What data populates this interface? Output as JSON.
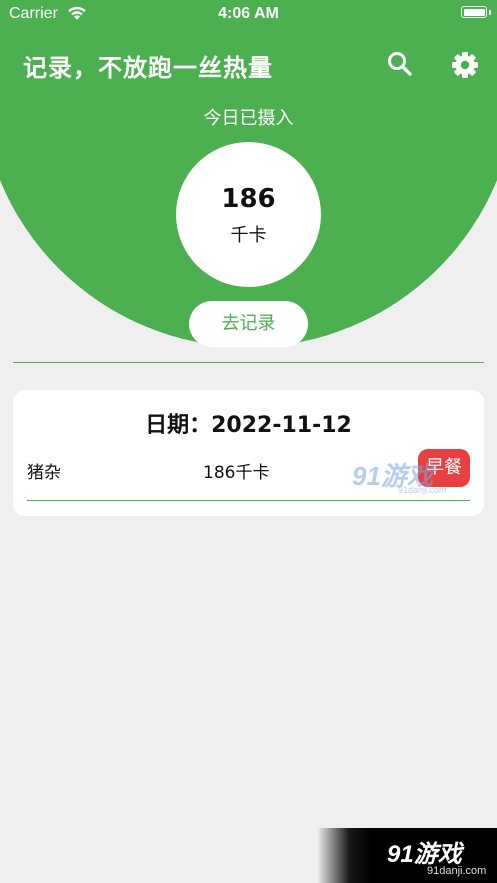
{
  "status_bar": {
    "carrier": "Carrier",
    "time": "4:06 AM"
  },
  "header": {
    "title": "记录，不放跑一丝热量",
    "search_icon": "search-icon",
    "settings_icon": "gear-icon"
  },
  "summary": {
    "label": "今日已摄入",
    "calories": "186",
    "unit": "千卡",
    "record_button": "去记录"
  },
  "records": [
    {
      "date": "日期：2022-11-12",
      "items": [
        {
          "name": "猪杂",
          "calories": "186千卡",
          "meal": "早餐"
        }
      ]
    }
  ],
  "watermarks": {
    "center": {
      "main": "91游戏",
      "sub": "91danji.com"
    },
    "corner": {
      "main": "91游戏",
      "sub": "91danji.com"
    }
  },
  "colors": {
    "accent": "#4caf50",
    "background": "#efefef",
    "meal_badge": "#e84040"
  }
}
